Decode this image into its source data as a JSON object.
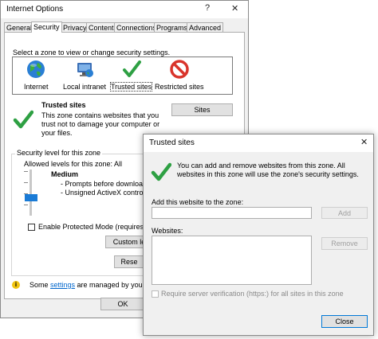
{
  "internet_options": {
    "title": "Internet Options",
    "help_icon": "?",
    "close_icon": "✕",
    "tabs": [
      {
        "label": "General"
      },
      {
        "label": "Security"
      },
      {
        "label": "Privacy"
      },
      {
        "label": "Content"
      },
      {
        "label": "Connections"
      },
      {
        "label": "Programs"
      },
      {
        "label": "Advanced"
      }
    ],
    "select_zone_text": "Select a zone to view or change security settings.",
    "zones": [
      {
        "label": "Internet",
        "icon": "globe-icon"
      },
      {
        "label": "Local intranet",
        "icon": "intranet-icon"
      },
      {
        "label": "Trusted sites",
        "icon": "checkmark-icon"
      },
      {
        "label": "Restricted sites",
        "icon": "no-entry-icon"
      }
    ],
    "zone_heading": "Trusted sites",
    "zone_description": "This zone contains websites that you trust not to damage your computer or your files.",
    "sites_button": "Sites",
    "security_group_label": "Security level for this zone",
    "allowed_levels": "Allowed levels for this zone: All",
    "level_name": "Medium",
    "level_bullets": [
      "- Prompts before downloadin",
      "- Unsigned ActiveX controls w"
    ],
    "protected_mode_label": "Enable Protected Mode (requires resta",
    "custom_level_button": "Custom le",
    "reset_button": "Rese",
    "info_text_before": "Some ",
    "info_link": "settings",
    "info_text_after": " are managed by your sys",
    "ok_button": "OK",
    "info_icon": "i"
  },
  "trusted_sites_dialog": {
    "title": "Trusted sites",
    "close_icon": "✕",
    "description": "You can add and remove websites from this zone. All websites in this zone will use the zone's security settings.",
    "add_label": "Add this website to the zone:",
    "add_input_value": "",
    "add_button": "Add",
    "websites_label": "Websites:",
    "remove_button": "Remove",
    "require_verification_label": "Require server verification (https:) for all sites in this zone",
    "close_button": "Close"
  },
  "colors": {
    "accent_green": "#2ea043",
    "restricted_red": "#d9342b",
    "link_blue": "#0066cc"
  }
}
